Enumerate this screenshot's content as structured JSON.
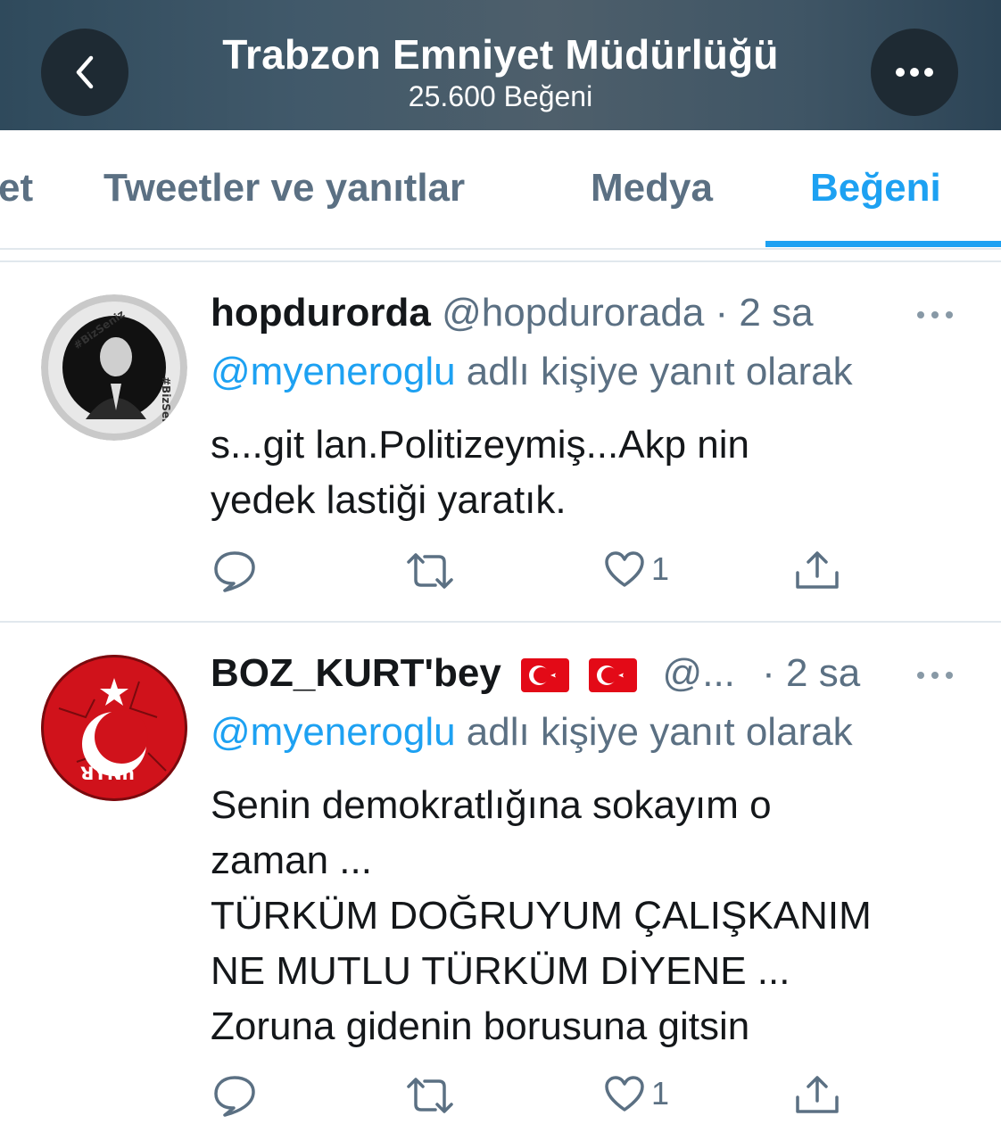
{
  "header": {
    "title": "Trabzon Emniyet Müdürlüğü",
    "subtitle": "25.600 Beğeni",
    "back_icon": "chevron-left-icon",
    "more_icon": "more-icon"
  },
  "tabs": [
    {
      "label": "et"
    },
    {
      "label": "Tweetler ve yanıtlar"
    },
    {
      "label": "Medya"
    },
    {
      "label": "Beğeni",
      "active": true
    }
  ],
  "colors": {
    "accent": "#1da1f2",
    "muted": "#5b7083",
    "text": "#14171a",
    "header_bg": "#41596a"
  },
  "tweets": [
    {
      "name": "hopdurorda",
      "handle": "@hopdurorada",
      "time": "· 2 sa",
      "reply_mention": "@myeneroglu",
      "reply_suffix": " adlı kişiye yanıt olarak",
      "text_lines": [
        "s...git lan.Politizeymiş...Akp nin",
        "yedek lastiği yaratık."
      ],
      "avatar_text": "#BizSeniz",
      "likes": "1"
    },
    {
      "name": "BOZ_KURT'bey",
      "handle": "@...",
      "time": "· 2 sa",
      "reply_mention": "@myeneroglu",
      "reply_suffix": " adlı kişiye yanıt olarak",
      "text_lines": [
        "Senin demokratlığına sokayım o",
        "zaman ...",
        "TÜRKÜM DOĞRUYUM ÇALIŞKANIM",
        "NE MUTLU TÜRKÜM DİYENE ...",
        "Zoruna gidenin borusuna gitsin"
      ],
      "avatar_text": "ꓤYꓠh",
      "likes": "1"
    }
  ]
}
